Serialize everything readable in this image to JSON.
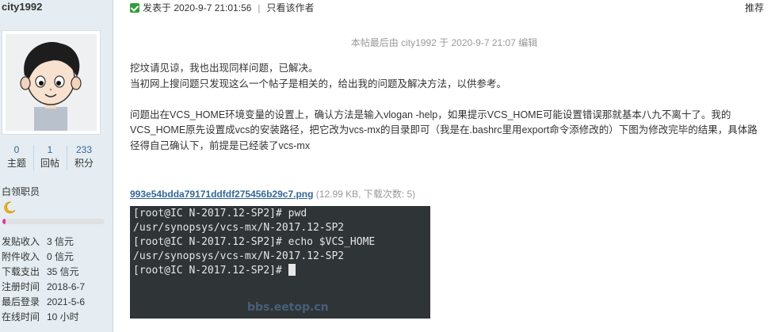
{
  "author": {
    "name": "city1992",
    "stats": [
      {
        "value": "0",
        "label": "主题"
      },
      {
        "value": "1",
        "label": "回帖"
      },
      {
        "value": "233",
        "label": "积分"
      }
    ],
    "group": "白领职员",
    "level_progress_percent": 3,
    "info": [
      {
        "key": "发贴收入",
        "value": "3 信元"
      },
      {
        "key": "附件收入",
        "value": "0 信元"
      },
      {
        "key": "下载支出",
        "value": "35 信元"
      },
      {
        "key": "注册时间",
        "value": "2018-6-7"
      },
      {
        "key": "最后登录",
        "value": "2021-5-6"
      },
      {
        "key": "在线时间",
        "value": "10 小时"
      }
    ]
  },
  "post": {
    "posted_label": "发表于 2020-9-7 21:01:56",
    "meta_separator": "|",
    "only_author": "只看该作者",
    "recommend": "推荐",
    "edit_note": "本帖最后由 city1992 于 2020-9-7 21:07 编辑",
    "paragraphs": [
      "挖坟请见谅，我也出现同样问题，已解决。",
      "当初网上搜问题只发现这么一个帖子是相关的，给出我的问题及解决方法，以供参考。",
      "问题出在VCS_HOME环境变量的设置上，确认方法是输入vlogan -help，如果提示VCS_HOME可能设置错误那就基本八九不离十了。我的VCS_HOME原先设置成vcs的安装路径，把它改为vcs-mx的目录即可（我是在.bashrc里用export命令添修改的）下图为修改完毕的结果，具体路径得自己确认下，前提是已经装了vcs-mx"
    ],
    "attachment": {
      "filename": "993e54bdda79171ddfdf275456b29c7.png",
      "meta": "(12.99 KB, 下载次数: 5)"
    },
    "terminal_lines": [
      "[root@IC N-2017.12-SP2]# pwd",
      "/usr/synopsys/vcs-mx/N-2017.12-SP2",
      "[root@IC N-2017.12-SP2]# echo $VCS_HOME",
      "/usr/synopsys/vcs-mx/N-2017.12-SP2",
      "[root@IC N-2017.12-SP2]# "
    ],
    "watermark": "bbs.eetop.cn"
  },
  "colors": {
    "sidebar_bg": "#e5edf2",
    "link": "#336699",
    "progress_fill": "#e0339d",
    "terminal_bg": "#2f3436",
    "online_icon": "#2f9e3a"
  },
  "icons": [
    "online-status-icon",
    "moon-rank-icon",
    "cartoon-avatar"
  ]
}
